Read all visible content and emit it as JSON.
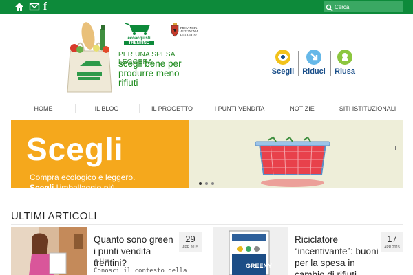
{
  "topbar": {
    "icons": [
      "home-icon",
      "mail-icon",
      "facebook-icon"
    ],
    "facebook_glyph": "f",
    "search_placeholder": "Cerca:"
  },
  "header": {
    "eco_logo_line1": "ecoacquisti",
    "eco_logo_line2": "TRENTINO",
    "province_line1": "PROVINCIA",
    "province_line2": "AUTONOMA",
    "province_line3": "DI TRENTO",
    "tagline_small": "PER UNA SPESA LEGGERA",
    "tagline_big_line1": "scegli bene per",
    "tagline_big_line2": "produrre meno rifiuti",
    "srr": [
      {
        "label": "Scegli",
        "icon": "eye-icon"
      },
      {
        "label": "Riduci",
        "icon": "arrow-down-icon"
      },
      {
        "label": "Riusa",
        "icon": "recycle-icon"
      }
    ]
  },
  "nav": {
    "items": [
      "HOME",
      "IL BLOG",
      "IL PROGETTO",
      "I PUNTI VENDITA",
      "NOTIZIE",
      "SITI ISTITUZIONALI"
    ]
  },
  "slider": {
    "title": "Scegli",
    "sub1": "Compra ecologico e leggero.",
    "sub2_bold": "Scegli",
    "sub2_rest": " l'imballaggio più"
  },
  "articles": {
    "section_title": "ULTIMI ARTICOLI",
    "items": [
      {
        "title": "Quanto sono green i punti vendita trentini?",
        "day": "29",
        "month": "APR 2015",
        "meta": "| |",
        "excerpt": "Conosci il contesto della"
      },
      {
        "title": "Riciclatore “incentivante”: buoni per la spesa in cambio di rifiuti",
        "day": "17",
        "month": "APR 2015",
        "image_text": "GREENY"
      }
    ]
  },
  "colors": {
    "topbar": "#0d8a3a",
    "slide_orange": "#f5a81c",
    "brand_blue": "#1a4f8a"
  }
}
